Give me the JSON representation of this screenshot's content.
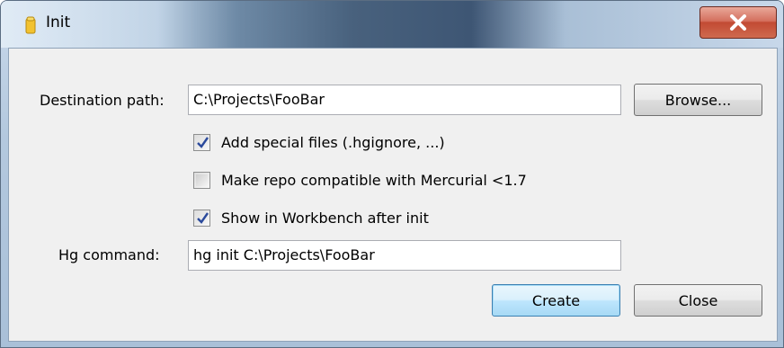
{
  "window": {
    "title": "Init",
    "close_glyph": "X"
  },
  "form": {
    "destination_label": "Destination path:",
    "destination_value": "C:\\Projects\\FooBar",
    "browse_label": "Browse...",
    "options": [
      {
        "label": "Add special files (.hgignore, ...)",
        "checked": true
      },
      {
        "label": "Make repo compatible with Mercurial <1.7",
        "checked": false
      },
      {
        "label": "Show in Workbench after init",
        "checked": true
      }
    ],
    "hg_command_label": "Hg command:",
    "hg_command_value": "hg init C:\\Projects\\FooBar"
  },
  "buttons": {
    "create_label": "Create",
    "close_label": "Close"
  },
  "icons": {
    "app": "tortoisehg-icon",
    "close": "close-icon",
    "check": "checkmark-icon"
  },
  "colors": {
    "close_button": "#c24a33",
    "default_button_border": "#3c7fb1",
    "dialog_bg": "#f0f0f0"
  }
}
